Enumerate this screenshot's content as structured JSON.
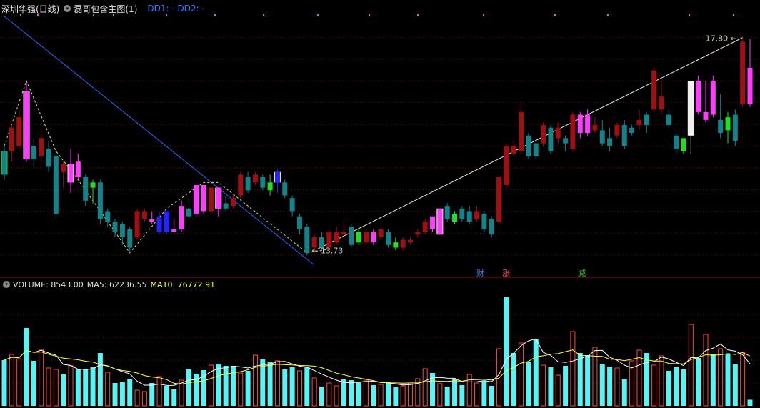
{
  "header": {
    "stock_label": "深圳华强(日线)",
    "indicator_name": "磊哥包含主图(1)",
    "dd_text": "DD1: -  DD2: -"
  },
  "volume_header": {
    "label": "VOLUME: 8543.00",
    "ma5": "MA5: 62236.55",
    "ma10": "MA10: 76772.91"
  },
  "event_tags": [
    {
      "text": "财",
      "color": "#3a7cff"
    },
    {
      "text": "涨",
      "color": "#ff4040"
    },
    {
      "text": "减",
      "color": "#30d030"
    }
  ],
  "colors": {
    "up": "#a00f14",
    "down": "#12848a",
    "pink": "#ff3cff",
    "green": "#20e020",
    "blue": "#2424ff",
    "white": "#f0f0f0",
    "vol_up": "#ff4a3a",
    "vol_down": "#55f5f5",
    "ma5": "#ffffff",
    "ma10": "#ffff40",
    "grid": "#6a1010",
    "trend_blue": "#2a62ff",
    "zigzag": "#e8e84a"
  },
  "chart_data": {
    "type": "candlestick",
    "price_labels": {
      "high": "17.80",
      "low": "13.73"
    },
    "ylim": [
      13.4,
      18.2
    ],
    "bars": [
      {
        "o": 15.6,
        "h": 15.75,
        "l": 15.05,
        "c": 15.15,
        "col": "down",
        "bg": "green",
        "vol": 64000,
        "vu": false
      },
      {
        "o": 15.6,
        "h": 16.1,
        "l": 15.4,
        "c": 16.05,
        "col": "up",
        "vol": 72000,
        "vu": true
      },
      {
        "o": 15.7,
        "h": 16.4,
        "l": 15.6,
        "c": 16.25,
        "col": "up",
        "vol": 66000,
        "vu": true
      },
      {
        "o": 15.45,
        "h": 16.95,
        "l": 15.4,
        "c": 16.75,
        "col": "pink",
        "bg": "white",
        "vol": 109000,
        "vu": false
      },
      {
        "o": 15.7,
        "h": 15.85,
        "l": 15.3,
        "c": 15.45,
        "col": "down",
        "vol": 63000,
        "vu": false
      },
      {
        "o": 15.5,
        "h": 15.95,
        "l": 15.4,
        "c": 15.85,
        "col": "up",
        "vol": 79000,
        "vu": true
      },
      {
        "o": 15.65,
        "h": 15.8,
        "l": 15.2,
        "c": 15.3,
        "col": "down",
        "vol": 53000,
        "vu": true
      },
      {
        "o": 15.5,
        "h": 15.6,
        "l": 14.3,
        "c": 14.4,
        "col": "down",
        "vol": 51000,
        "vu": true
      },
      {
        "o": 15.2,
        "h": 15.4,
        "l": 14.9,
        "c": 15.35,
        "col": "up",
        "vol": 44000,
        "vu": false
      },
      {
        "o": 15.35,
        "h": 15.65,
        "l": 14.8,
        "c": 15.0,
        "col": "pink",
        "bg": "white",
        "vol": 56000,
        "vu": true
      },
      {
        "o": 15.4,
        "h": 15.55,
        "l": 15.05,
        "c": 15.1,
        "col": "pink",
        "vol": 52000,
        "vu": false
      },
      {
        "o": 15.1,
        "h": 15.15,
        "l": 14.55,
        "c": 14.65,
        "col": "down",
        "vol": 52000,
        "vu": false
      },
      {
        "o": 14.9,
        "h": 15.05,
        "l": 14.6,
        "c": 15.0,
        "col": "green",
        "vol": 54000,
        "vu": false
      },
      {
        "o": 15.0,
        "h": 15.05,
        "l": 14.2,
        "c": 14.3,
        "col": "down",
        "vol": 74000,
        "vu": false
      },
      {
        "o": 14.45,
        "h": 14.5,
        "l": 14.15,
        "c": 14.25,
        "col": "down",
        "vol": 47000,
        "vu": true
      },
      {
        "o": 14.25,
        "h": 14.3,
        "l": 13.95,
        "c": 14.05,
        "col": "down",
        "vol": 32000,
        "vu": false
      },
      {
        "o": 14.2,
        "h": 14.25,
        "l": 13.8,
        "c": 13.95,
        "col": "down",
        "vol": 33000,
        "vu": false
      },
      {
        "o": 14.1,
        "h": 14.15,
        "l": 13.65,
        "c": 13.75,
        "col": "down",
        "vol": 38000,
        "vu": false
      },
      {
        "o": 13.95,
        "h": 14.5,
        "l": 13.9,
        "c": 14.45,
        "col": "up",
        "vol": 22000,
        "vu": true
      },
      {
        "o": 14.3,
        "h": 14.5,
        "l": 14.25,
        "c": 14.45,
        "col": "up",
        "vol": 20000,
        "vu": true
      },
      {
        "o": 14.25,
        "h": 14.45,
        "l": 14.2,
        "c": 14.3,
        "col": "pink",
        "vol": 32000,
        "vu": false
      },
      {
        "o": 14.05,
        "h": 14.45,
        "l": 14.0,
        "c": 14.35,
        "col": "blue",
        "vol": 41000,
        "vu": true
      },
      {
        "o": 14.05,
        "h": 14.45,
        "l": 14.0,
        "c": 14.45,
        "col": "blue",
        "vol": 28000,
        "vu": false
      },
      {
        "o": 14.1,
        "h": 14.3,
        "l": 14.05,
        "c": 14.05,
        "col": "pink",
        "vol": 23000,
        "vu": false
      },
      {
        "o": 14.1,
        "h": 14.65,
        "l": 14.05,
        "c": 14.55,
        "col": "pink",
        "vol": 36000,
        "vu": true
      },
      {
        "o": 14.5,
        "h": 14.7,
        "l": 14.3,
        "c": 14.35,
        "col": "down",
        "vol": 52000,
        "vu": false
      },
      {
        "o": 14.4,
        "h": 14.95,
        "l": 14.35,
        "c": 14.95,
        "col": "pink",
        "vol": 45000,
        "vu": false
      },
      {
        "o": 14.45,
        "h": 14.95,
        "l": 14.4,
        "c": 14.95,
        "col": "pink",
        "vol": 50000,
        "vu": false
      },
      {
        "o": 14.9,
        "h": 14.95,
        "l": 14.4,
        "c": 14.45,
        "col": "up",
        "vol": 57000,
        "vu": true
      },
      {
        "o": 14.5,
        "h": 14.9,
        "l": 14.35,
        "c": 14.9,
        "col": "pink",
        "bg": "white",
        "vol": 58000,
        "vu": false
      },
      {
        "o": 14.5,
        "h": 14.75,
        "l": 14.45,
        "c": 14.6,
        "col": "down",
        "vol": 56000,
        "vu": false
      },
      {
        "o": 14.7,
        "h": 14.75,
        "l": 14.5,
        "c": 14.55,
        "col": "up",
        "vol": 56000,
        "vu": false
      },
      {
        "o": 14.75,
        "h": 15.2,
        "l": 14.7,
        "c": 15.15,
        "col": "up",
        "vol": 46000,
        "vu": true
      },
      {
        "o": 15.1,
        "h": 15.2,
        "l": 14.8,
        "c": 14.85,
        "col": "down",
        "vol": 49000,
        "vu": false
      },
      {
        "o": 15.15,
        "h": 15.2,
        "l": 14.95,
        "c": 15.0,
        "col": "up",
        "vol": 71000,
        "vu": true
      },
      {
        "o": 15.1,
        "h": 15.15,
        "l": 14.85,
        "c": 14.9,
        "col": "down",
        "vol": 65000,
        "vu": false
      },
      {
        "o": 14.85,
        "h": 15.15,
        "l": 14.75,
        "c": 15.0,
        "col": "green",
        "vol": 61000,
        "vu": false
      },
      {
        "o": 15.0,
        "h": 15.25,
        "l": 14.8,
        "c": 15.2,
        "col": "blue",
        "bg": "white",
        "vol": 63000,
        "vu": true
      },
      {
        "o": 15.0,
        "h": 15.05,
        "l": 14.7,
        "c": 14.75,
        "col": "down",
        "vol": 51000,
        "vu": false
      },
      {
        "o": 14.7,
        "h": 14.75,
        "l": 14.35,
        "c": 14.45,
        "col": "down",
        "vol": 54000,
        "vu": false
      },
      {
        "o": 14.35,
        "h": 14.4,
        "l": 14.0,
        "c": 14.1,
        "col": "down",
        "vol": 49000,
        "vu": true
      },
      {
        "o": 14.15,
        "h": 14.2,
        "l": 13.6,
        "c": 13.65,
        "col": "down",
        "vol": 54000,
        "vu": false
      },
      {
        "o": 13.95,
        "h": 14.0,
        "l": 13.7,
        "c": 13.75,
        "col": "up",
        "vol": 39000,
        "vu": true
      },
      {
        "o": 13.95,
        "h": 14.05,
        "l": 13.7,
        "c": 13.75,
        "col": "down",
        "vol": 27000,
        "vu": false
      },
      {
        "o": 13.75,
        "h": 14.1,
        "l": 13.7,
        "c": 14.05,
        "col": "up",
        "vol": 32000,
        "vu": true
      },
      {
        "o": 13.85,
        "h": 14.15,
        "l": 13.8,
        "c": 14.05,
        "col": "up",
        "vol": 28000,
        "vu": true
      },
      {
        "o": 14.05,
        "h": 14.25,
        "l": 13.95,
        "c": 14.0,
        "col": "up",
        "vol": 38000,
        "vu": false
      },
      {
        "o": 14.15,
        "h": 14.2,
        "l": 13.75,
        "c": 13.8,
        "col": "down",
        "vol": 36000,
        "vu": false
      },
      {
        "o": 13.85,
        "h": 14.1,
        "l": 13.8,
        "c": 14.05,
        "col": "green",
        "vol": 33000,
        "vu": false
      },
      {
        "o": 14.05,
        "h": 14.1,
        "l": 13.8,
        "c": 13.85,
        "col": "up",
        "vol": 36000,
        "vu": true
      },
      {
        "o": 13.85,
        "h": 14.1,
        "l": 13.8,
        "c": 14.05,
        "col": "pink",
        "vol": 29000,
        "vu": false
      },
      {
        "o": 14.1,
        "h": 14.15,
        "l": 13.9,
        "c": 13.95,
        "col": "up",
        "vol": 30000,
        "vu": true
      },
      {
        "o": 14.05,
        "h": 14.1,
        "l": 13.75,
        "c": 13.8,
        "col": "down",
        "vol": 33000,
        "vu": false
      },
      {
        "o": 13.85,
        "h": 13.95,
        "l": 13.7,
        "c": 13.75,
        "col": "green",
        "vol": 26000,
        "vu": false
      },
      {
        "o": 13.9,
        "h": 13.95,
        "l": 13.7,
        "c": 13.75,
        "col": "up",
        "vol": 28000,
        "vu": true
      },
      {
        "o": 13.9,
        "h": 13.95,
        "l": 13.8,
        "c": 13.85,
        "col": "up",
        "vol": 32000,
        "vu": true
      },
      {
        "o": 14.0,
        "h": 14.1,
        "l": 13.95,
        "c": 14.05,
        "col": "up",
        "vol": 38000,
        "vu": true
      },
      {
        "o": 14.25,
        "h": 14.3,
        "l": 14.0,
        "c": 14.05,
        "col": "up",
        "vol": 52000,
        "vu": true
      },
      {
        "o": 14.1,
        "h": 14.35,
        "l": 14.05,
        "c": 14.35,
        "col": "pink",
        "vol": 46000,
        "vu": false
      },
      {
        "o": 14.5,
        "h": 14.5,
        "l": 14.0,
        "c": 14.0,
        "col": "pink",
        "bg": "white",
        "vol": 31000,
        "vu": true
      },
      {
        "o": 14.55,
        "h": 14.6,
        "l": 14.25,
        "c": 14.3,
        "col": "down",
        "vol": 27000,
        "vu": false
      },
      {
        "o": 14.25,
        "h": 14.45,
        "l": 14.2,
        "c": 14.4,
        "col": "green",
        "vol": 37000,
        "vu": false
      },
      {
        "o": 14.5,
        "h": 14.55,
        "l": 14.25,
        "c": 14.3,
        "col": "down",
        "vol": 29000,
        "vu": false
      },
      {
        "o": 14.45,
        "h": 14.55,
        "l": 14.2,
        "c": 14.25,
        "col": "down",
        "vol": 44000,
        "vu": true
      },
      {
        "o": 14.45,
        "h": 14.55,
        "l": 14.25,
        "c": 14.3,
        "col": "up",
        "vol": 32000,
        "vu": true
      },
      {
        "o": 14.4,
        "h": 14.45,
        "l": 14.05,
        "c": 14.1,
        "col": "down",
        "vol": 35000,
        "vu": false
      },
      {
        "o": 14.3,
        "h": 14.35,
        "l": 13.95,
        "c": 14.0,
        "col": "down",
        "vol": 28000,
        "vu": false
      },
      {
        "o": 14.25,
        "h": 15.15,
        "l": 14.2,
        "c": 15.1,
        "col": "up",
        "vol": 80000,
        "vu": true
      },
      {
        "o": 14.95,
        "h": 15.75,
        "l": 14.9,
        "c": 15.7,
        "col": "up",
        "vol": 152000,
        "vu": false
      },
      {
        "o": 15.55,
        "h": 15.8,
        "l": 15.5,
        "c": 15.7,
        "col": "up",
        "vol": 74000,
        "vu": false
      },
      {
        "o": 16.35,
        "h": 16.5,
        "l": 15.55,
        "c": 15.6,
        "col": "up",
        "vol": 88000,
        "vu": true
      },
      {
        "o": 15.9,
        "h": 15.95,
        "l": 15.45,
        "c": 15.5,
        "col": "down",
        "vol": 61000,
        "vu": false
      },
      {
        "o": 15.5,
        "h": 15.8,
        "l": 15.45,
        "c": 15.75,
        "col": "down",
        "vol": 94000,
        "vu": false
      },
      {
        "o": 15.75,
        "h": 16.15,
        "l": 15.7,
        "c": 16.1,
        "col": "up",
        "vol": 57000,
        "vu": true
      },
      {
        "o": 15.6,
        "h": 16.1,
        "l": 15.55,
        "c": 16.05,
        "col": "down",
        "vol": 54000,
        "vu": false
      },
      {
        "o": 15.85,
        "h": 16.15,
        "l": 15.75,
        "c": 16.05,
        "col": "up",
        "vol": 43000,
        "vu": true
      },
      {
        "o": 15.75,
        "h": 15.9,
        "l": 15.6,
        "c": 15.85,
        "col": "down",
        "vol": 56000,
        "vu": false
      },
      {
        "o": 15.65,
        "h": 16.35,
        "l": 15.6,
        "c": 16.3,
        "col": "up",
        "vol": 104000,
        "vu": true
      },
      {
        "o": 15.95,
        "h": 16.35,
        "l": 15.85,
        "c": 16.3,
        "col": "pink",
        "vol": 74000,
        "vu": false
      },
      {
        "o": 15.95,
        "h": 16.4,
        "l": 15.9,
        "c": 16.3,
        "col": "pink",
        "vol": 71000,
        "vu": false
      },
      {
        "o": 16.0,
        "h": 16.25,
        "l": 15.95,
        "c": 16.1,
        "col": "up",
        "vol": 82000,
        "vu": true
      },
      {
        "o": 16.0,
        "h": 16.2,
        "l": 15.7,
        "c": 15.75,
        "col": "down",
        "vol": 58000,
        "vu": false
      },
      {
        "o": 15.85,
        "h": 16.05,
        "l": 15.6,
        "c": 15.7,
        "col": "down",
        "vol": 55000,
        "vu": false
      },
      {
        "o": 16.1,
        "h": 16.15,
        "l": 15.85,
        "c": 15.9,
        "col": "up",
        "vol": 53000,
        "vu": true
      },
      {
        "o": 16.1,
        "h": 16.2,
        "l": 15.65,
        "c": 15.7,
        "col": "down",
        "vol": 37000,
        "vu": false
      },
      {
        "o": 16.05,
        "h": 16.1,
        "l": 15.9,
        "c": 15.95,
        "col": "down",
        "vol": 63000,
        "vu": true
      },
      {
        "o": 16.2,
        "h": 16.4,
        "l": 16.0,
        "c": 16.1,
        "col": "up",
        "vol": 78000,
        "vu": true
      },
      {
        "o": 16.1,
        "h": 16.35,
        "l": 15.95,
        "c": 16.3,
        "col": "down",
        "vol": 74000,
        "vu": false
      },
      {
        "o": 16.4,
        "h": 17.2,
        "l": 16.35,
        "c": 17.15,
        "col": "up",
        "vol": 57000,
        "vu": true
      },
      {
        "o": 16.65,
        "h": 16.95,
        "l": 16.3,
        "c": 16.4,
        "col": "up",
        "vol": 70000,
        "vu": true
      },
      {
        "o": 16.3,
        "h": 16.4,
        "l": 16.05,
        "c": 16.1,
        "col": "down",
        "vol": 49000,
        "vu": false
      },
      {
        "o": 15.65,
        "h": 15.95,
        "l": 15.55,
        "c": 15.9,
        "col": "down",
        "vol": 55000,
        "vu": false
      },
      {
        "o": 15.6,
        "h": 15.85,
        "l": 15.55,
        "c": 15.85,
        "col": "green",
        "vol": 51000,
        "vu": false
      },
      {
        "o": 15.9,
        "h": 16.95,
        "l": 15.55,
        "c": 16.95,
        "col": "white",
        "bg": "white",
        "vol": 114000,
        "vu": true
      },
      {
        "o": 16.35,
        "h": 17.05,
        "l": 16.3,
        "c": 16.95,
        "col": "pink",
        "vol": 67000,
        "vu": false
      },
      {
        "o": 16.2,
        "h": 16.95,
        "l": 16.15,
        "c": 16.35,
        "col": "pink",
        "vol": 100000,
        "vu": true
      },
      {
        "o": 16.3,
        "h": 17.05,
        "l": 16.25,
        "c": 16.95,
        "col": "pink",
        "vol": 72000,
        "vu": false
      },
      {
        "o": 16.2,
        "h": 16.7,
        "l": 15.85,
        "c": 15.95,
        "col": "down",
        "vol": 80000,
        "vu": true
      },
      {
        "o": 16.25,
        "h": 16.35,
        "l": 15.75,
        "c": 16.0,
        "col": "green",
        "vol": 73000,
        "vu": false
      },
      {
        "o": 16.3,
        "h": 16.4,
        "l": 15.7,
        "c": 15.8,
        "col": "down",
        "vol": 58000,
        "vu": false
      },
      {
        "o": 16.5,
        "h": 17.8,
        "l": 16.45,
        "c": 17.7,
        "col": "up",
        "vol": 75000,
        "vu": true
      },
      {
        "o": 16.5,
        "h": 17.75,
        "l": 16.45,
        "c": 17.2,
        "col": "pink",
        "vol": 8543,
        "vu": false
      }
    ]
  }
}
